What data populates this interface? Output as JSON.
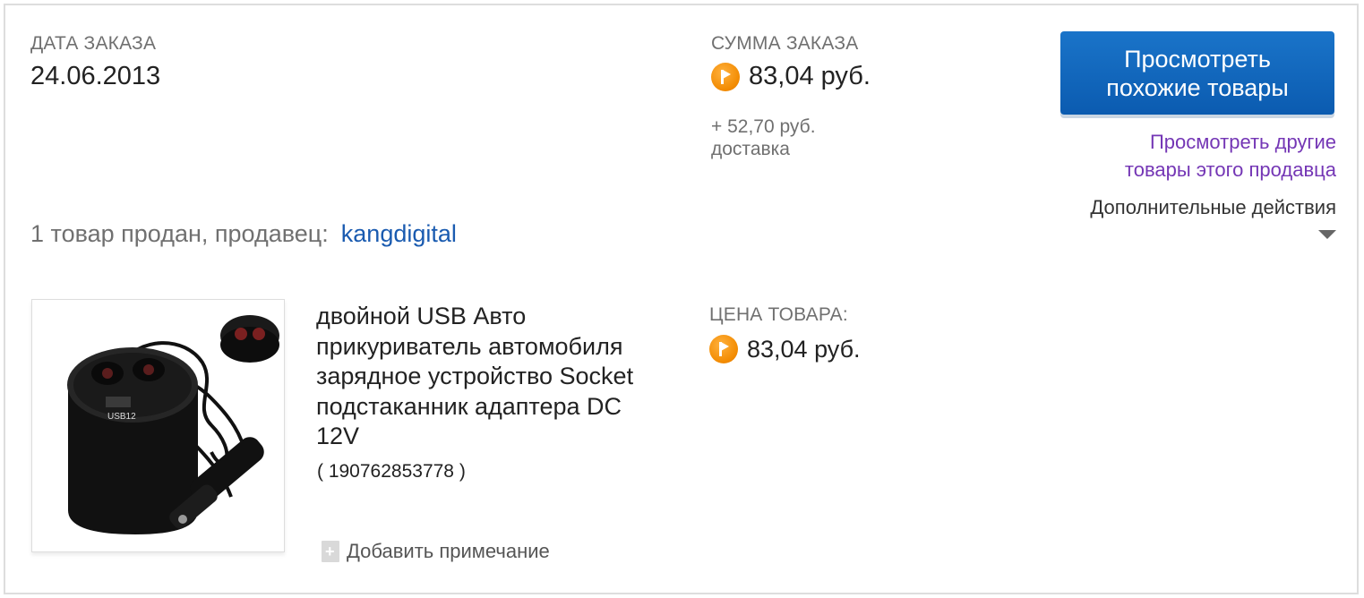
{
  "order": {
    "date_label": "ДАТА ЗАКАЗА",
    "date": "24.06.2013",
    "total_label": "СУММА ЗАКАЗА",
    "total": "83,04 руб.",
    "shipping_line1": "+ 52,70 руб.",
    "shipping_line2": "доставка"
  },
  "actions": {
    "primary_line1": "Просмотреть",
    "primary_line2": "похожие товары",
    "other_seller_line1": "Просмотреть другие",
    "other_seller_line2": "товары этого продавца",
    "more_actions": "Дополнительные действия"
  },
  "seller": {
    "prefix": "1 товар продан, продавец:",
    "name": "kangdigital"
  },
  "item": {
    "title_lines": [
      "двойной USB Авто",
      "прикуриватель автомобиля",
      "зарядное устройство Socket",
      "подстаканник адаптера DC",
      "12V"
    ],
    "id": "( 190762853778 )",
    "price_label": "ЦЕНА ТОВАРА:",
    "price": "83,04 руб.",
    "add_note": "Добавить примечание",
    "image_text": "USB12"
  },
  "icons": {
    "currency": "coin-icon",
    "dropdown": "caret-down-icon",
    "note": "add-note-icon"
  },
  "colors": {
    "primary_button": "#0b5bb0",
    "link_purple": "#7436b5",
    "link_blue": "#1a5bb0",
    "coin": "#f28a00"
  }
}
